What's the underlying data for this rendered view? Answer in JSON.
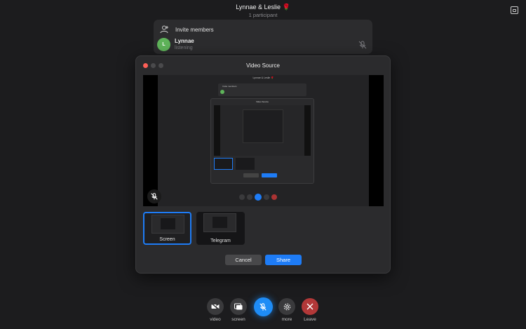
{
  "header": {
    "title": "Lynnae & Leslie",
    "flower": "🌹",
    "subtitle": "1 participant"
  },
  "members_panel": {
    "invite_label": "Invite members",
    "members": [
      {
        "initial": "L",
        "name": "Lynnae",
        "status": "listening"
      }
    ]
  },
  "dialog": {
    "title": "Video Source",
    "preview": {
      "mini_title": "Lynnae & Leslie 🌹",
      "mini_invite": "Invite members",
      "mini_dialog_title": "Video Source"
    },
    "sources": [
      {
        "label": "Screen",
        "selected": true
      },
      {
        "label": "Telegram",
        "selected": false
      }
    ],
    "cancel_label": "Cancel",
    "share_label": "Share"
  },
  "bottom_bar": {
    "video_label": "video",
    "screen_label": "screen",
    "more_label": "more",
    "leave_label": "Leave"
  },
  "colors": {
    "accent": "#1e7cf6",
    "leave": "#b23838",
    "avatar": "#5fb45a",
    "close_dot": "#fe5f57"
  }
}
